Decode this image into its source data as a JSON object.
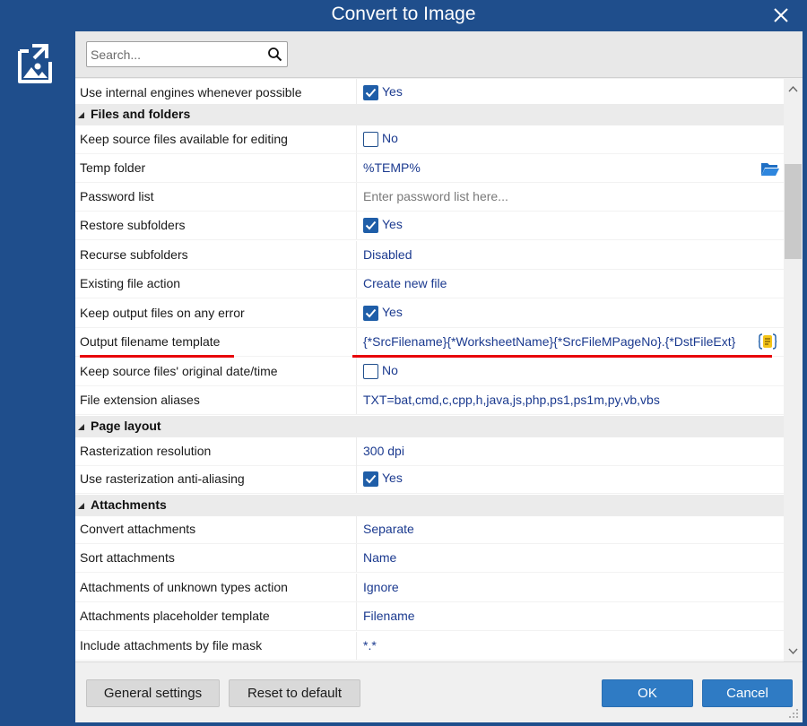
{
  "window": {
    "title": "Convert to Image"
  },
  "search": {
    "placeholder": "Search..."
  },
  "rows": {
    "use_internal_engines": {
      "label": "Use internal engines whenever possible",
      "value": "Yes"
    },
    "keep_source_files": {
      "label": "Keep source files available for editing",
      "value": "No"
    },
    "temp_folder": {
      "label": "Temp folder",
      "value": "%TEMP%"
    },
    "password_list": {
      "label": "Password list",
      "placeholder": "Enter password list here..."
    },
    "restore_subfolders": {
      "label": "Restore subfolders",
      "value": "Yes"
    },
    "recurse_subfolders": {
      "label": "Recurse subfolders",
      "value": "Disabled"
    },
    "existing_file_action": {
      "label": "Existing file action",
      "value": "Create new file"
    },
    "keep_output_files": {
      "label": "Keep output files on any error",
      "value": "Yes"
    },
    "output_filename_template": {
      "label": "Output filename template",
      "value": "{*SrcFilename}{*WorksheetName}{*SrcFileMPageNo}.{*DstFileExt}"
    },
    "keep_original_datetime": {
      "label": "Keep source files' original date/time",
      "value": "No"
    },
    "file_extension_aliases": {
      "label": "File extension aliases",
      "value": "TXT=bat,cmd,c,cpp,h,java,js,php,ps1,ps1m,py,vb,vbs"
    },
    "rasterization_resolution": {
      "label": "Rasterization resolution",
      "value": "300 dpi"
    },
    "rasterization_antialiasing": {
      "label": "Use rasterization anti-aliasing",
      "value": "Yes"
    },
    "convert_attachments": {
      "label": "Convert attachments",
      "value": "Separate"
    },
    "sort_attachments": {
      "label": "Sort attachments",
      "value": "Name"
    },
    "unknown_attachments_action": {
      "label": "Attachments of unknown types action",
      "value": "Ignore"
    },
    "attachments_placeholder": {
      "label": "Attachments placeholder template",
      "value": "Filename"
    },
    "include_attachments_mask": {
      "label": "Include attachments by file mask",
      "value": "*.*"
    }
  },
  "sections": {
    "files_and_folders": "Files and folders",
    "page_layout": "Page layout",
    "attachments": "Attachments"
  },
  "footer": {
    "general_settings": "General settings",
    "reset_to_default": "Reset to default",
    "ok": "OK",
    "cancel": "Cancel"
  },
  "icons": {
    "app": "image-export-icon",
    "close": "close-icon",
    "search": "search-icon",
    "folder": "folder-open-icon",
    "macro": "macro-braces-icon",
    "checkbox_checked": "check-icon"
  },
  "colors": {
    "titlebar": "#1f4e8c",
    "value_text": "#1b3a8f",
    "checkbox": "#1f5ea8",
    "highlight_underline": "#e8000a",
    "primary_button": "#2f7bc4"
  }
}
